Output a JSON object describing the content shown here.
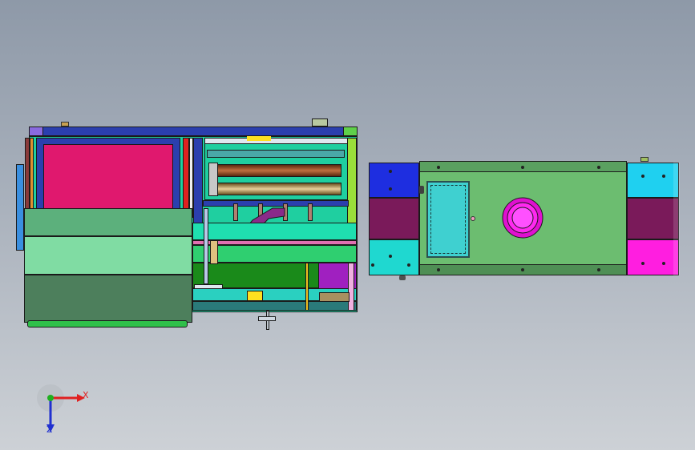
{
  "viewport": {
    "background_top": "#8e99a8",
    "background_bottom": "#cdd1d6"
  },
  "triad": {
    "x_label": "X",
    "z_label": "Z",
    "x_color": "#e02020",
    "z_color": "#2030d0",
    "y_color": "#20b020"
  },
  "colors": {
    "frame_blue": "#2b3fae",
    "panel_magenta": "#e0186e",
    "drum_green": "#6fbf85",
    "drum_light": "#80dca3",
    "drum_dark": "#4d7f5c",
    "base_green": "#6cbd70",
    "platform_cyan": "#1fe0d8",
    "violet": "#8a2a8a",
    "magenta": "#ff1ee0",
    "roller_brown": "#8a4a20",
    "roller_gold": "#c9a86a"
  }
}
